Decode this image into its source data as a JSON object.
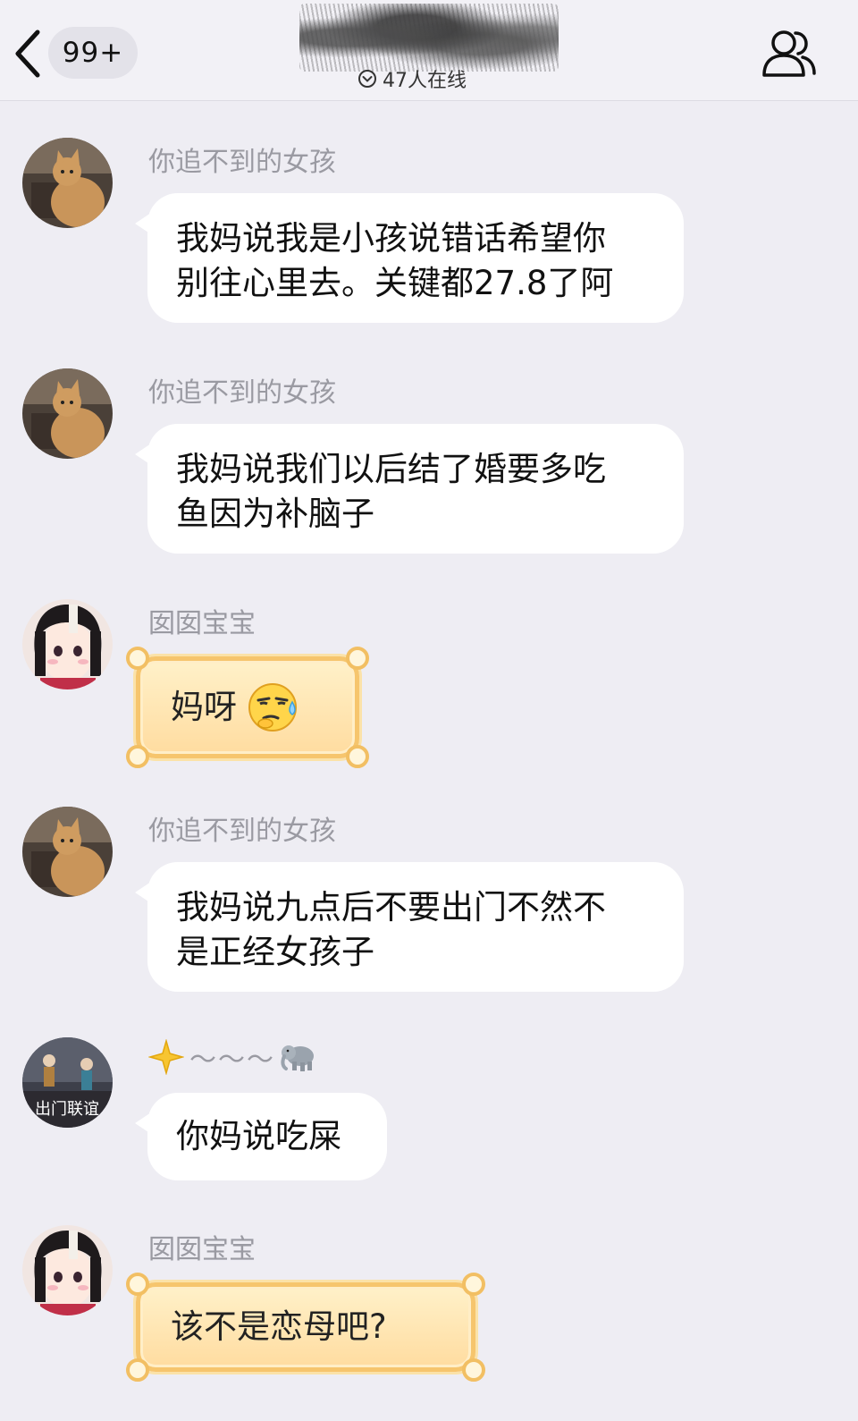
{
  "header": {
    "unread_badge": "99+",
    "online_status": "47人在线",
    "back_icon": "chevron-left-icon",
    "members_icon": "group-members-icon"
  },
  "messages": [
    {
      "sender": "你追不到的女孩",
      "avatar": "cat-avatar",
      "style": "white",
      "lines": [
        "我妈说我是小孩说错话希望你",
        "别往心里去。关键都27.8了阿"
      ]
    },
    {
      "sender": "你追不到的女孩",
      "avatar": "cat-avatar",
      "style": "white",
      "lines": [
        "我妈说我们以后结了婚要多吃",
        "鱼因为补脑子"
      ]
    },
    {
      "sender": "囡囡宝宝",
      "avatar": "anime-girl-avatar",
      "style": "gold",
      "lines": [
        "妈呀"
      ],
      "emoji": "sweat-smirk-emoji"
    },
    {
      "sender": "你追不到的女孩",
      "avatar": "cat-avatar",
      "style": "white",
      "lines": [
        "我妈说九点后不要出门不然不",
        "是正经女孩子"
      ]
    },
    {
      "sender": "～～～",
      "sender_prefix_icon": "sparkle-star-icon",
      "sender_suffix_icon": "elephant-icon",
      "avatar": "game-scene-avatar",
      "avatar_text": "出门联谊",
      "style": "white",
      "lines": [
        "你妈说吃屎"
      ]
    },
    {
      "sender": "囡囡宝宝",
      "avatar": "anime-girl-avatar",
      "style": "gold",
      "lines": [
        "该不是恋母吧?"
      ]
    }
  ],
  "colors": {
    "background": "#eeedf3",
    "bubble_white": "#ffffff",
    "bubble_gold": "#ffe3a8",
    "sender_gray": "#9a9aa2"
  }
}
